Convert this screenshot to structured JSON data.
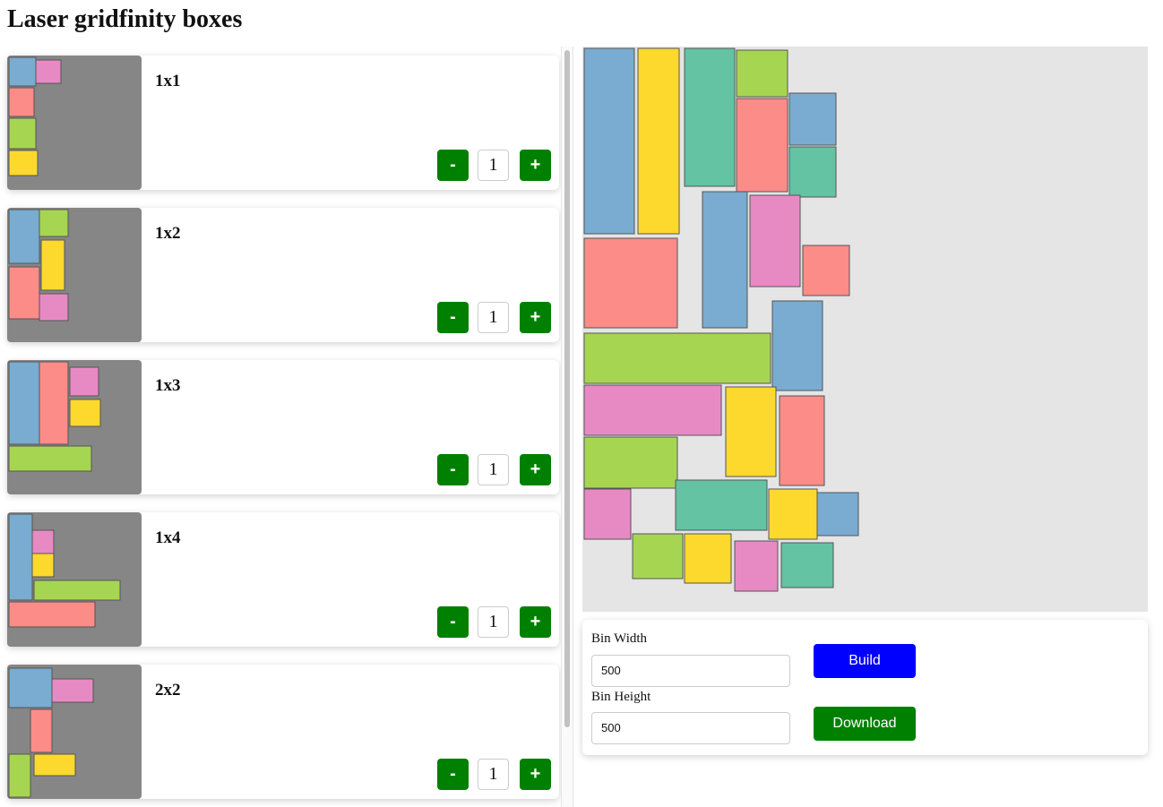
{
  "page": {
    "title": "Laser gridfinity boxes"
  },
  "boxes": [
    {
      "label": "1x1",
      "quantity": "1",
      "minus_label": "-",
      "plus_label": "+"
    },
    {
      "label": "1x2",
      "quantity": "1",
      "minus_label": "-",
      "plus_label": "+"
    },
    {
      "label": "1x3",
      "quantity": "1",
      "minus_label": "-",
      "plus_label": "+"
    },
    {
      "label": "1x4",
      "quantity": "1",
      "minus_label": "-",
      "plus_label": "+"
    },
    {
      "label": "2x2",
      "quantity": "1",
      "minus_label": "-",
      "plus_label": "+"
    }
  ],
  "settings": {
    "bin_width_label": "Bin Width",
    "bin_width_value": "500",
    "bin_height_label": "Bin Height",
    "bin_height_value": "500",
    "build_label": "Build",
    "download_label": "Download"
  },
  "colors": {
    "add_remove_button": "#008000",
    "build_button": "#0000ff",
    "download_button": "#008000",
    "thumbnail_bg": "#868686",
    "preview_bg": "#e5e5e5",
    "piece_blue": "#79acd0",
    "piece_yellow": "#fdd92d",
    "piece_teal": "#63c3a3",
    "piece_green": "#a6d651",
    "piece_red": "#fc8c88",
    "piece_pink": "#e78ac4"
  }
}
